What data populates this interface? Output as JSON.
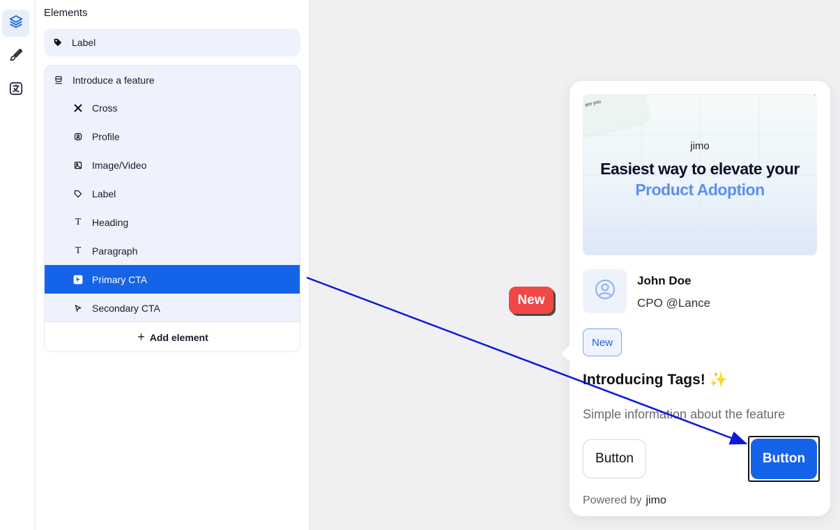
{
  "rail": {
    "items": [
      {
        "icon": "layers-icon",
        "active": true
      },
      {
        "icon": "brush-icon",
        "active": false
      },
      {
        "icon": "translate-icon",
        "active": false
      }
    ]
  },
  "panel": {
    "title": "Elements",
    "single_group": {
      "label": "Label",
      "icon": "label-icon"
    },
    "group": {
      "label": "Introduce a feature",
      "icon": "step-icon",
      "items": [
        {
          "label": "Cross",
          "icon": "cross-icon"
        },
        {
          "label": "Profile",
          "icon": "profile-icon"
        },
        {
          "label": "Image/Video",
          "icon": "image-icon"
        },
        {
          "label": "Label",
          "icon": "tag-icon"
        },
        {
          "label": "Heading",
          "icon": "heading-icon"
        },
        {
          "label": "Paragraph",
          "icon": "paragraph-icon"
        },
        {
          "label": "Primary CTA",
          "icon": "cursor-icon",
          "selected": true
        },
        {
          "label": "Secondary CTA",
          "icon": "cursor-icon"
        }
      ],
      "add_label": "Add element"
    }
  },
  "canvas": {
    "hotspot_badge": "New",
    "tour": {
      "media": {
        "corner_text": "are you",
        "logo": "jimo",
        "headline_1": "Easiest way to elevate your",
        "headline_2": "Product Adoption"
      },
      "profile": {
        "name": "John Doe",
        "role": "CPO @Lance"
      },
      "tag": "New",
      "heading": "Introducing Tags! ✨",
      "paragraph": "Simple information about the feature",
      "secondary_button": "Button",
      "primary_button": "Button",
      "powered_by": "Powered by",
      "brand": "jimo"
    }
  },
  "colors": {
    "accent": "#1563e8",
    "badge": "#f04747",
    "panel_bg": "#eef2fc",
    "canvas_bg": "#f0f0f3",
    "arrow": "#0a1ad8"
  }
}
